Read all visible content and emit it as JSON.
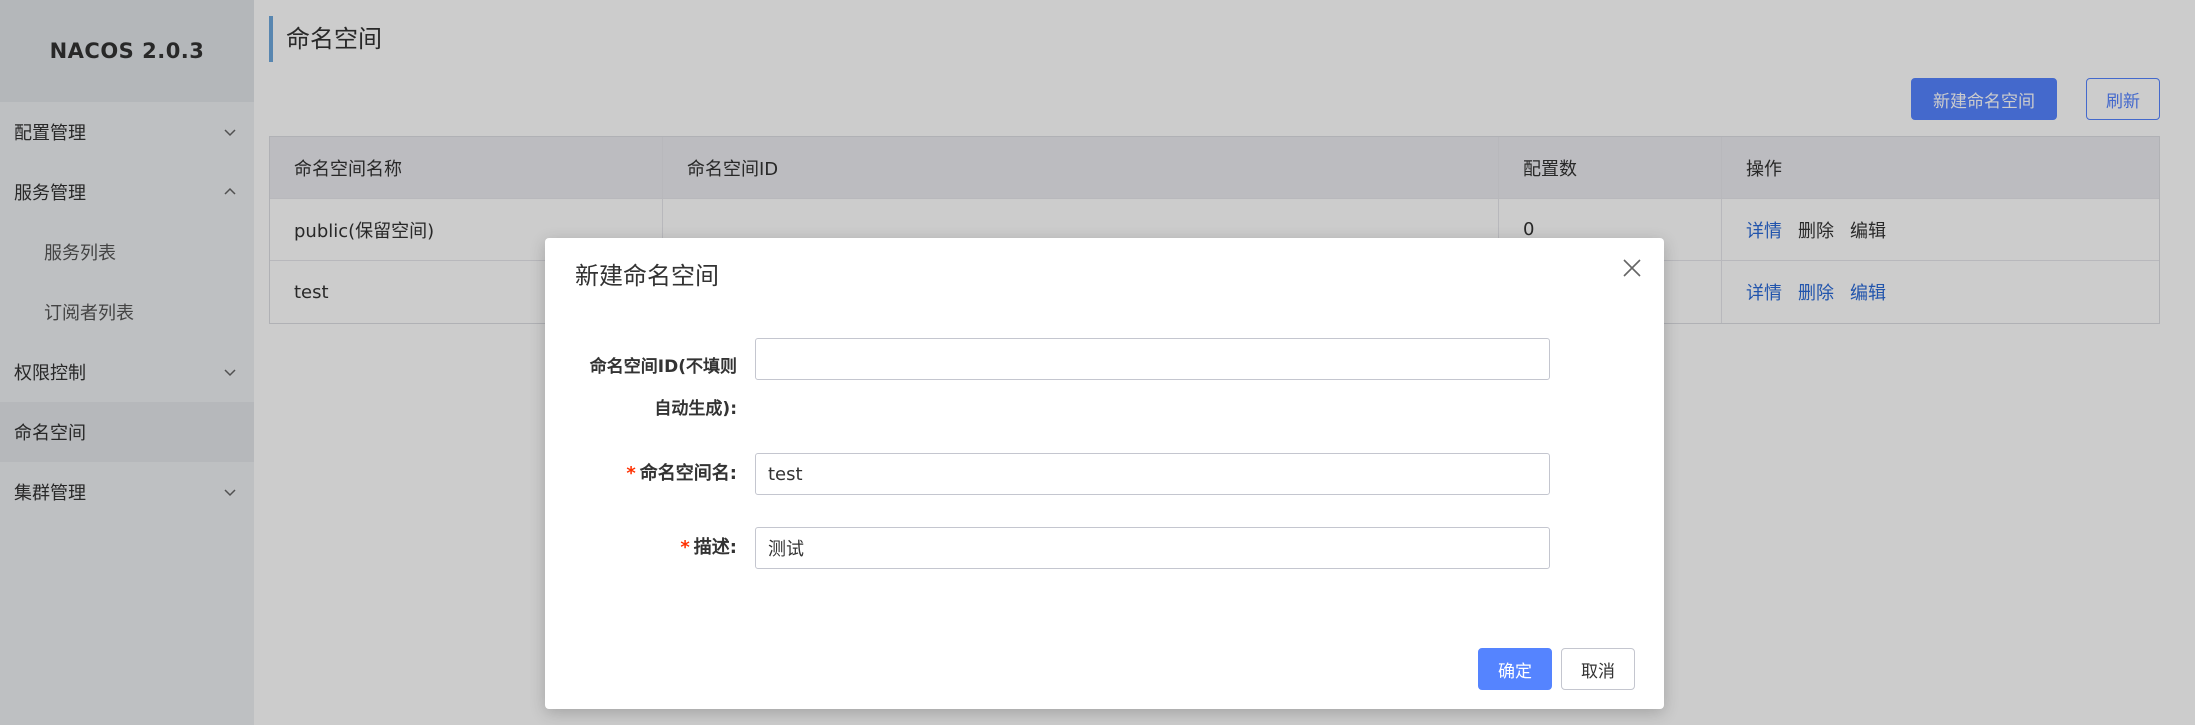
{
  "app": {
    "logo": "NACOS 2.0.3"
  },
  "sidebar": {
    "items": [
      {
        "label": "配置管理"
      },
      {
        "label": "服务管理"
      },
      {
        "label": "服务列表"
      },
      {
        "label": "订阅者列表"
      },
      {
        "label": "权限控制"
      },
      {
        "label": "命名空间"
      },
      {
        "label": "集群管理"
      }
    ]
  },
  "page": {
    "title": "命名空间",
    "create_button": "新建命名空间",
    "refresh_button": "刷新"
  },
  "table": {
    "headers": [
      "命名空间名称",
      "命名空间ID",
      "配置数",
      "操作"
    ],
    "rows": [
      {
        "name": "public(保留空间)",
        "id": "",
        "count": "0"
      },
      {
        "name": "test",
        "id": "",
        "count": ""
      }
    ],
    "actions": {
      "detail": "详情",
      "delete": "删除",
      "edit": "编辑"
    }
  },
  "dialog": {
    "title": "新建命名空间",
    "id_label_line1": "命名空间ID(不填则",
    "id_label_line2": "自动生成):",
    "id_value": "",
    "name_label": "命名空间名:",
    "name_value": "test",
    "desc_label": "描述:",
    "desc_value": "测试",
    "required_mark": "*",
    "confirm_button": "确定",
    "cancel_button": "取消"
  },
  "colors": {
    "primary": "#5584ff",
    "link": "#2a6ad8",
    "required": "#ff3000"
  }
}
